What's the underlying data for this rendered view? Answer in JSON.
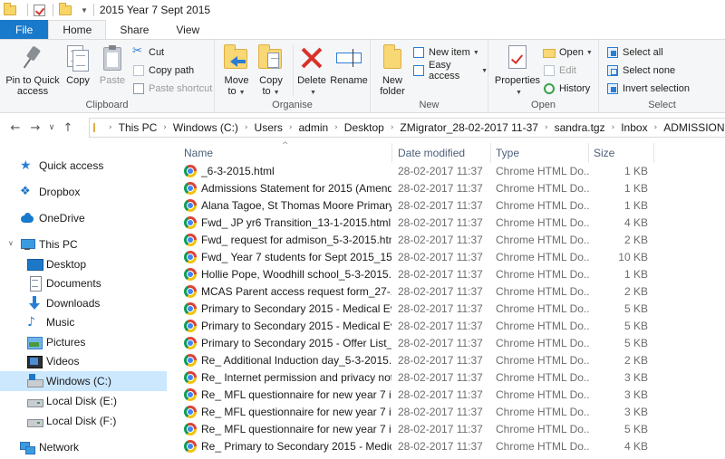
{
  "window": {
    "title": "2015 Year 7 Sept 2015"
  },
  "tabs": [
    {
      "label": "File"
    },
    {
      "label": "Home"
    },
    {
      "label": "Share"
    },
    {
      "label": "View"
    }
  ],
  "ribbon": {
    "clipboard": {
      "label": "Clipboard",
      "pin_line1": "Pin to Quick",
      "pin_line2": "access",
      "copy": "Copy",
      "paste": "Paste",
      "cut": "Cut",
      "copy_path": "Copy path",
      "paste_shortcut": "Paste shortcut"
    },
    "organise": {
      "label": "Organise",
      "move_to_line1": "Move",
      "move_to_line2": "to",
      "copy_to_line1": "Copy",
      "copy_to_line2": "to",
      "delete": "Delete",
      "rename": "Rename"
    },
    "new": {
      "label": "New",
      "new_folder_line1": "New",
      "new_folder_line2": "folder",
      "new_item": "New item",
      "easy_access": "Easy access"
    },
    "open": {
      "label": "Open",
      "properties": "Properties",
      "open": "Open",
      "edit": "Edit",
      "history": "History"
    },
    "select": {
      "label": "Select",
      "select_all": "Select all",
      "select_none": "Select none",
      "invert_selection": "Invert selection"
    }
  },
  "address": {
    "segments": [
      "This PC",
      "Windows (C:)",
      "Users",
      "admin",
      "Desktop",
      "ZMigrator_28-02-2017 11-37",
      "sandra.tgz",
      "Inbox",
      "ADMISSIONS - PRIM"
    ]
  },
  "navpane": {
    "quick_access": "Quick access",
    "dropbox": "Dropbox",
    "onedrive": "OneDrive",
    "this_pc": "This PC",
    "desktop": "Desktop",
    "documents": "Documents",
    "downloads": "Downloads",
    "music": "Music",
    "pictures": "Pictures",
    "videos": "Videos",
    "windows_c": "Windows (C:)",
    "local_e": "Local Disk (E:)",
    "local_f": "Local Disk (F:)",
    "network": "Network"
  },
  "columns": {
    "name": "Name",
    "date": "Date modified",
    "type": "Type",
    "size": "Size"
  },
  "files": [
    {
      "name": "_6-3-2015.html",
      "date": "28-02-2017 11:37",
      "type": "Chrome HTML Do...",
      "size": "1 KB"
    },
    {
      "name": "Admissions Statement for 2015 (Amende...",
      "date": "28-02-2017 11:37",
      "type": "Chrome HTML Do...",
      "size": "1 KB"
    },
    {
      "name": "Alana Tagoe, St Thomas Moore Primary ...",
      "date": "28-02-2017 11:37",
      "type": "Chrome HTML Do...",
      "size": "1 KB"
    },
    {
      "name": "Fwd_ JP yr6 Transition_13-1-2015.html",
      "date": "28-02-2017 11:37",
      "type": "Chrome HTML Do...",
      "size": "4 KB"
    },
    {
      "name": "Fwd_ request for admison_5-3-2015.html",
      "date": "28-02-2017 11:37",
      "type": "Chrome HTML Do...",
      "size": "2 KB"
    },
    {
      "name": "Fwd_ Year 7 students for Sept 2015_15-12...",
      "date": "28-02-2017 11:37",
      "type": "Chrome HTML Do...",
      "size": "10 KB"
    },
    {
      "name": "Hollie Pope, Woodhill school_5-3-2015.h...",
      "date": "28-02-2017 11:37",
      "type": "Chrome HTML Do...",
      "size": "1 KB"
    },
    {
      "name": "MCAS Parent access request form_27-1-2...",
      "date": "28-02-2017 11:37",
      "type": "Chrome HTML Do...",
      "size": "2 KB"
    },
    {
      "name": "Primary to Secondary 2015 - Medical Evi...",
      "date": "28-02-2017 11:37",
      "type": "Chrome HTML Do...",
      "size": "5 KB"
    },
    {
      "name": "Primary to Secondary 2015 - Medical Evi...",
      "date": "28-02-2017 11:37",
      "type": "Chrome HTML Do...",
      "size": "5 KB"
    },
    {
      "name": "Primary to Secondary 2015 - Offer List_25...",
      "date": "28-02-2017 11:37",
      "type": "Chrome HTML Do...",
      "size": "5 KB"
    },
    {
      "name": "Re_ Additional Induction day_5-3-2015.ht...",
      "date": "28-02-2017 11:37",
      "type": "Chrome HTML Do...",
      "size": "2 KB"
    },
    {
      "name": "Re_ Internet permission and privacy notic...",
      "date": "28-02-2017 11:37",
      "type": "Chrome HTML Do...",
      "size": "3 KB"
    },
    {
      "name": "Re_ MFL questionnaire for new year 7 in ...",
      "date": "28-02-2017 11:37",
      "type": "Chrome HTML Do...",
      "size": "3 KB"
    },
    {
      "name": "Re_ MFL questionnaire for new year 7 in ...",
      "date": "28-02-2017 11:37",
      "type": "Chrome HTML Do...",
      "size": "3 KB"
    },
    {
      "name": "Re_ MFL questionnaire for new year 7 in ...",
      "date": "28-02-2017 11:37",
      "type": "Chrome HTML Do...",
      "size": "5 KB"
    },
    {
      "name": "Re_ Primary to Secondary 2015 - Medical ...",
      "date": "28-02-2017 11:37",
      "type": "Chrome HTML Do...",
      "size": "4 KB"
    }
  ],
  "icons": {
    "file_icon": "chrome-html-icon",
    "accent": "#1979ca",
    "selected_bg": "#cce8ff"
  }
}
